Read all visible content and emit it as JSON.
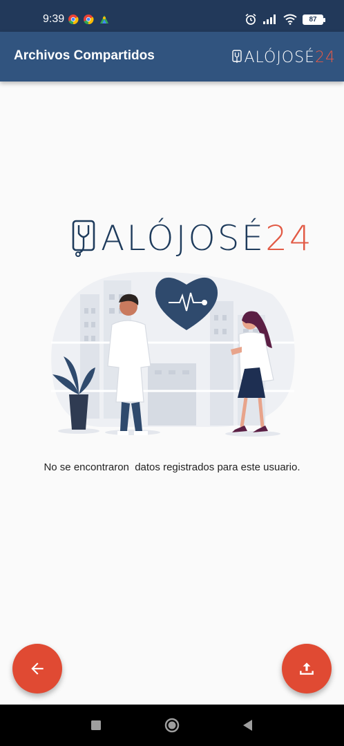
{
  "status_bar": {
    "time": "9:39",
    "battery": "87",
    "notification_icons": [
      "chrome-icon",
      "chrome-icon",
      "maps-icon"
    ],
    "right_icons": [
      "alarm-icon",
      "signal-icon",
      "wifi-icon",
      "battery-icon"
    ]
  },
  "app_bar": {
    "title": "Archivos Compartidos",
    "brand_text": "ALÓJOSÉ",
    "brand_number": "24"
  },
  "main": {
    "logo_text": "ALÓJOSÉ",
    "logo_number": "24",
    "empty_message": "No se encontraron  datos registrados para este usuario."
  },
  "actions": {
    "back_icon": "arrow-back-icon",
    "upload_icon": "upload-icon"
  },
  "colors": {
    "status_bar": "#22395a",
    "app_bar": "#31547f",
    "fab": "#e04a33",
    "brand_dark": "#1e3b5c",
    "brand_accent": "#e25a45"
  }
}
